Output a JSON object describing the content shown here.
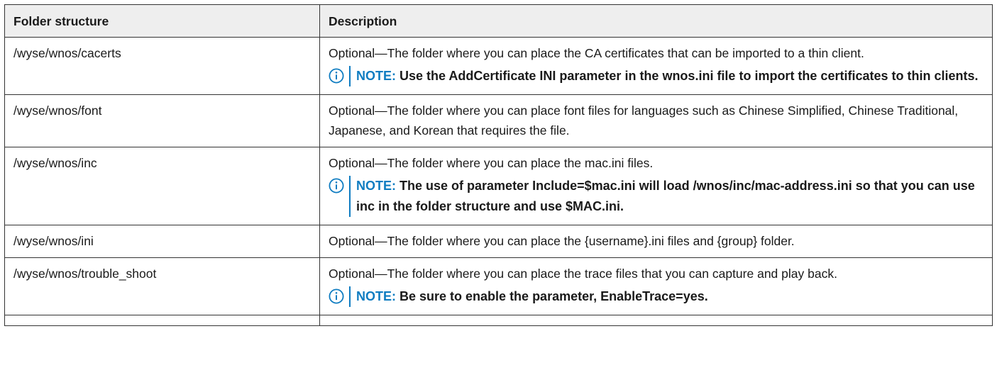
{
  "table": {
    "headers": [
      "Folder structure",
      "Description"
    ],
    "note_label": "NOTE:",
    "rows": [
      {
        "path": "/wyse/wnos/cacerts",
        "description": "Optional—The folder where you can place the CA certificates that can be imported to a thin client.",
        "note": "Use the AddCertificate INI parameter in the wnos.ini file to import the certificates to thin clients."
      },
      {
        "path": "/wyse/wnos/font",
        "description": "Optional—The folder where you can place font files for languages such as Chinese Simplified, Chinese Traditional, Japanese, and Korean that requires the file.",
        "note": null
      },
      {
        "path": "/wyse/wnos/inc",
        "description": "Optional—The folder where you can place the mac.ini files.",
        "note": "The use of parameter Include=$mac.ini will load /wnos/inc/mac-address.ini so that you can use inc in the folder structure and use $MAC.ini."
      },
      {
        "path": "/wyse/wnos/ini",
        "description": "Optional—The folder where you can place the {username}.ini files and {group} folder.",
        "note": null
      },
      {
        "path": "/wyse/wnos/trouble_shoot",
        "description": "Optional—The folder where you can place the trace files that you can capture and play back.",
        "note": "Be sure to enable the parameter, EnableTrace=yes."
      }
    ]
  },
  "colors": {
    "note_accent": "#0e7cc1",
    "header_bg": "#eeeeee",
    "border": "#333333"
  },
  "icons": {
    "note": "info-circle-icon"
  }
}
